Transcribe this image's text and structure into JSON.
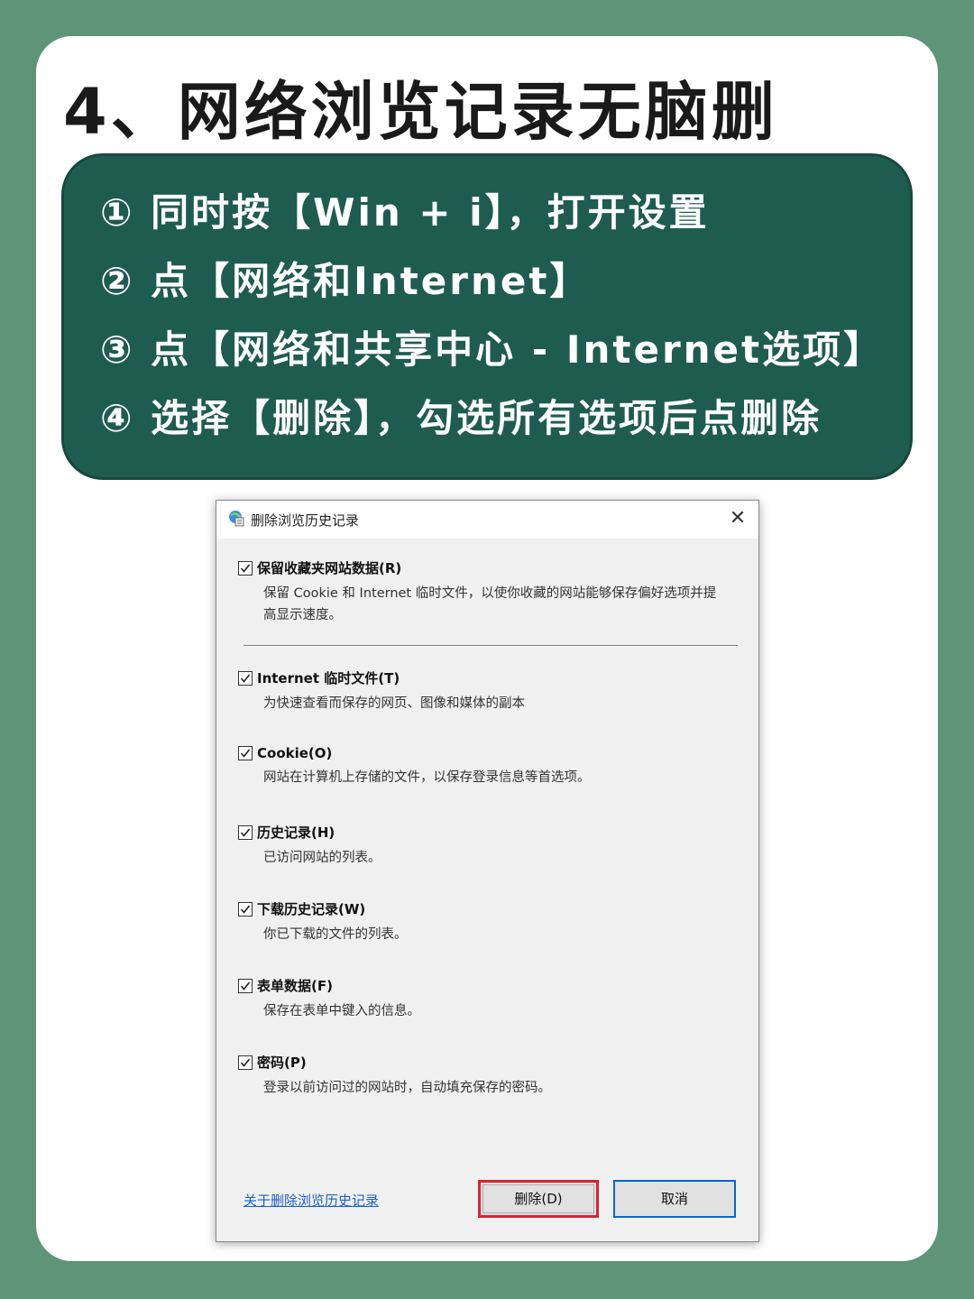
{
  "page_title": "4、网络浏览记录无脑删",
  "steps": [
    "① 同时按【Win + i】，打开设置",
    "② 点【网络和Internet】",
    "③ 点【网络和共享中心 - Internet选项】",
    "④ 选择【删除】，勾选所有选项后点删除"
  ],
  "dialog": {
    "title": "删除浏览历史记录",
    "close_glyph": "✕",
    "options": [
      {
        "label": "保留收藏夹网站数据(R)",
        "desc": "保留 Cookie 和 Internet 临时文件，以使你收藏的网站能够保存偏好选项并提高显示速度。",
        "checked": true
      },
      {
        "label": "Internet 临时文件(T)",
        "desc": "为快速查看而保存的网页、图像和媒体的副本",
        "checked": true
      },
      {
        "label": "Cookie(O)",
        "desc": "网站在计算机上存储的文件，以保存登录信息等首选项。",
        "checked": true
      },
      {
        "label": "历史记录(H)",
        "desc": "已访问网站的列表。",
        "checked": true
      },
      {
        "label": "下载历史记录(W)",
        "desc": "你已下载的文件的列表。",
        "checked": true
      },
      {
        "label": "表单数据(F)",
        "desc": "保存在表单中键入的信息。",
        "checked": true
      },
      {
        "label": "密码(P)",
        "desc": "登录以前访问过的网站时，自动填充保存的密码。",
        "checked": true
      }
    ],
    "about_link": "关于删除浏览历史记录",
    "delete_button": "删除(D)",
    "cancel_button": "取消"
  },
  "colors": {
    "background": "#5e9478",
    "steps_panel": "#1f5c50",
    "highlight": "#d9232e",
    "link": "#1a5fd0"
  }
}
